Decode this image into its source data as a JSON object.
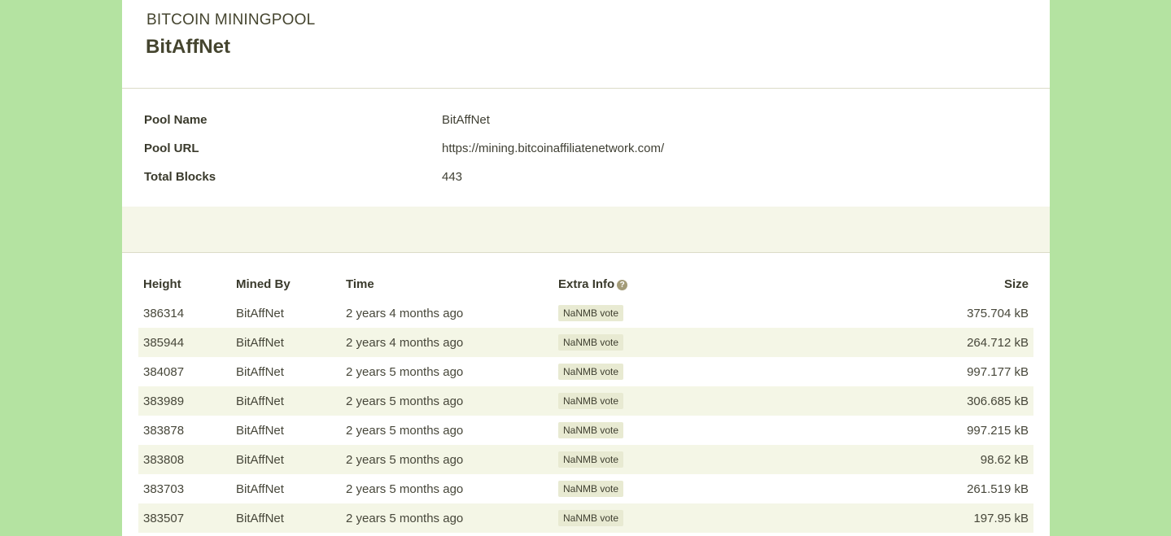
{
  "header": {
    "eyebrow": "BITCOIN MININGPOOL",
    "title": "BitAffNet"
  },
  "info": [
    {
      "label": "Pool Name",
      "value": "BitAffNet"
    },
    {
      "label": "Pool URL",
      "value": "https://mining.bitcoinaffiliatenetwork.com/"
    },
    {
      "label": "Total Blocks",
      "value": "443"
    }
  ],
  "table": {
    "headers": {
      "height": "Height",
      "mined_by": "Mined By",
      "time": "Time",
      "extra_info": "Extra Info",
      "size": "Size"
    },
    "help_icon": "question-circle-icon",
    "rows": [
      {
        "height": "386314",
        "mined_by": "BitAffNet",
        "time": "2 years 4 months ago",
        "extra": "NaNMB vote",
        "size": "375.704 kB"
      },
      {
        "height": "385944",
        "mined_by": "BitAffNet",
        "time": "2 years 4 months ago",
        "extra": "NaNMB vote",
        "size": "264.712 kB"
      },
      {
        "height": "384087",
        "mined_by": "BitAffNet",
        "time": "2 years 5 months ago",
        "extra": "NaNMB vote",
        "size": "997.177 kB"
      },
      {
        "height": "383989",
        "mined_by": "BitAffNet",
        "time": "2 years 5 months ago",
        "extra": "NaNMB vote",
        "size": "306.685 kB"
      },
      {
        "height": "383878",
        "mined_by": "BitAffNet",
        "time": "2 years 5 months ago",
        "extra": "NaNMB vote",
        "size": "997.215 kB"
      },
      {
        "height": "383808",
        "mined_by": "BitAffNet",
        "time": "2 years 5 months ago",
        "extra": "NaNMB vote",
        "size": "98.62 kB"
      },
      {
        "height": "383703",
        "mined_by": "BitAffNet",
        "time": "2 years 5 months ago",
        "extra": "NaNMB vote",
        "size": "261.519 kB"
      },
      {
        "height": "383507",
        "mined_by": "BitAffNet",
        "time": "2 years 5 months ago",
        "extra": "NaNMB vote",
        "size": "197.95 kB"
      }
    ]
  },
  "colors": {
    "page_background": "#b4e3a1",
    "band": "#f5f6e8",
    "row_alt": "#f4f6e6",
    "badge": "#e8ead2"
  }
}
